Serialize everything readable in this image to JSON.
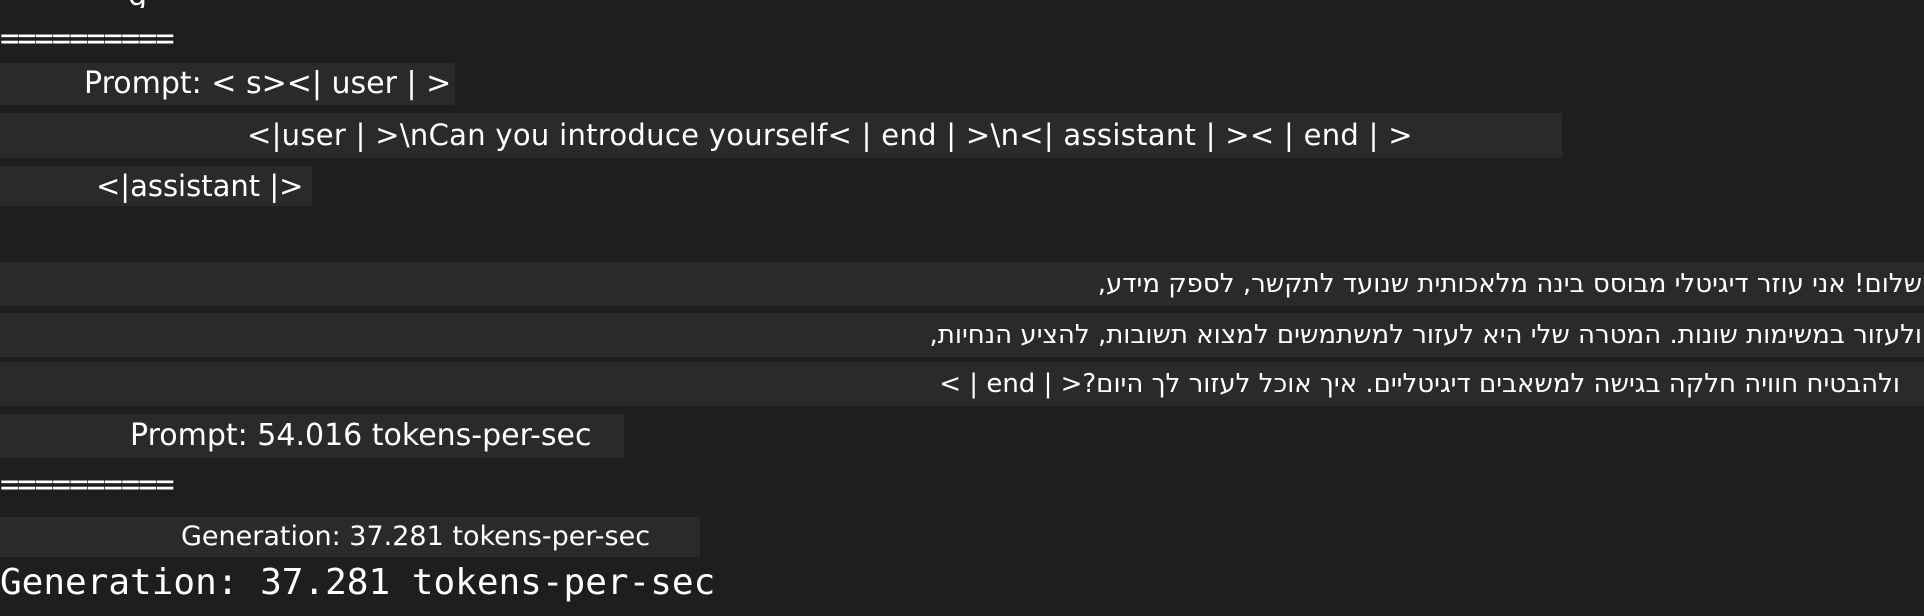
{
  "terminal": {
    "colors": {
      "background": "#1e1e1e",
      "highlight": "#2a2a2a",
      "text": "#ffffff"
    },
    "separator_top": "==========",
    "prompt_line1": "Prompt: < s><| user | >",
    "prompt_line2": "<|user | >\\nCan you introduce yourself< | end | >\\n<| assistant | >< | end | >",
    "prompt_line3": "<|assistant |>",
    "response_line1": "שלום! אני עוזר דיגיטלי מבוסס בינה מלאכותית שנועד לתקשר, לספק מידע,",
    "response_line2": "ולעזור במשימות שונות. המטרה שלי היא לעזור למשתמשים למצוא תשובות, להציע הנחיות,",
    "response_line3": "ולהבטיח חוויה חלקה בגישה למשאבים דיגיטליים. איך אוכל לעזור לך היום?< | end | >",
    "prompt_speed": "Prompt: 54.016 tokens-per-sec",
    "separator_bottom": "==========",
    "generation_speed_highlight": "Generation: 37.281 tokens-per-sec",
    "generation_speed": "Generation: 37.281 tokens-per-sec"
  }
}
